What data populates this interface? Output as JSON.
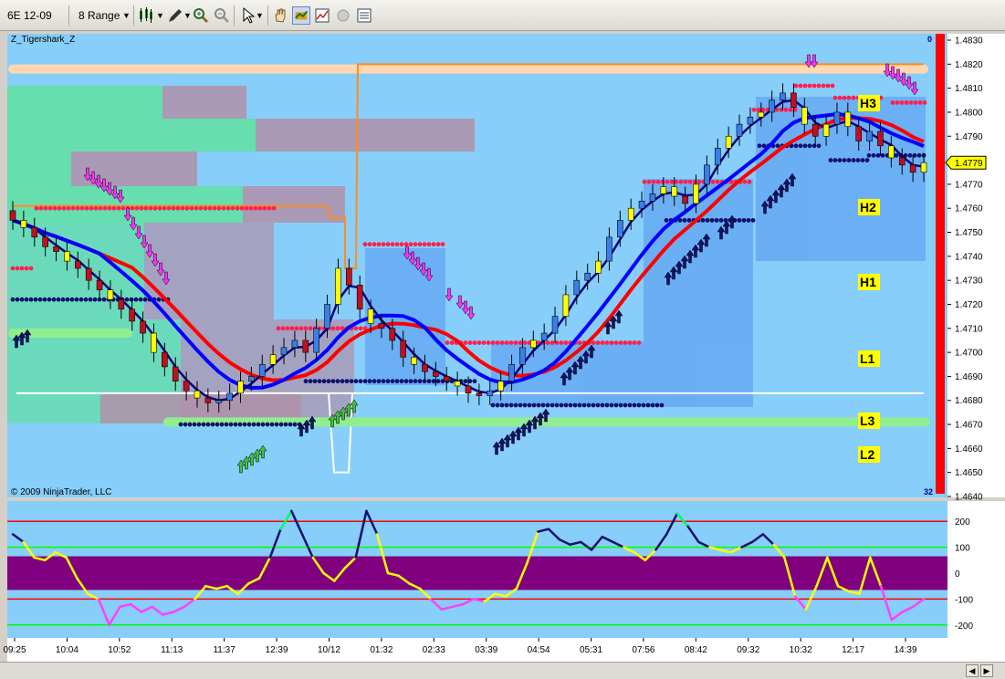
{
  "toolbar": {
    "instrument": "6E 12-09",
    "bar_type": "8 Range"
  },
  "chart_data": {
    "type": "candlestick",
    "title": "Z_Tigershark_Z",
    "copyright": "© 2009 NinjaTrader, LLC",
    "price_axis": {
      "ylim": [
        1.464,
        1.483
      ],
      "ticks": [
        "1.4830",
        "1.4820",
        "1.4810",
        "1.4800",
        "1.4790",
        "1.4780",
        "1.4770",
        "1.4760",
        "1.4750",
        "1.4740",
        "1.4730",
        "1.4720",
        "1.4710",
        "1.4700",
        "1.4690",
        "1.4680",
        "1.4670",
        "1.4660",
        "1.4650",
        "1.4640"
      ]
    },
    "last_price": "1.4779",
    "corner_top": "0",
    "corner_bottom": "32",
    "pivot_levels": [
      {
        "name": "H3",
        "price": 1.4818
      },
      {
        "name": "H2",
        "price": 1.4771
      },
      {
        "name": "H1",
        "price": 1.4741
      },
      {
        "name": "L1",
        "price": 1.471
      },
      {
        "name": "L3",
        "price": 1.4683
      },
      {
        "name": "L2",
        "price": 1.4671
      }
    ],
    "time_labels": [
      "09:25",
      "10:04",
      "10:52",
      "11:13",
      "11:37",
      "12:39",
      "10/12",
      "01:32",
      "02:33",
      "03:39",
      "04:54",
      "05:31",
      "07:56",
      "08:42",
      "09:32",
      "10:32",
      "12:17",
      "14:39"
    ],
    "close_series": [
      1.4755,
      1.4752,
      1.4748,
      1.4744,
      1.4742,
      1.4738,
      1.4735,
      1.473,
      1.4726,
      1.4722,
      1.4718,
      1.4713,
      1.4708,
      1.47,
      1.4694,
      1.4688,
      1.4684,
      1.4681,
      1.4679,
      1.468,
      1.4683,
      1.4688,
      1.469,
      1.4695,
      1.4699,
      1.4702,
      1.4705,
      1.47,
      1.471,
      1.472,
      1.4735,
      1.4728,
      1.4718,
      1.4712,
      1.471,
      1.4705,
      1.4698,
      1.4695,
      1.4692,
      1.469,
      1.4688,
      1.4686,
      1.4683,
      1.4682,
      1.4684,
      1.4688,
      1.4695,
      1.4702,
      1.4705,
      1.4708,
      1.4715,
      1.4724,
      1.473,
      1.4733,
      1.4738,
      1.4748,
      1.4755,
      1.476,
      1.4763,
      1.4766,
      1.4769,
      1.4765,
      1.4762,
      1.477,
      1.4778,
      1.4785,
      1.479,
      1.4795,
      1.4798,
      1.48,
      1.4805,
      1.4808,
      1.4802,
      1.4795,
      1.479,
      1.4795,
      1.48,
      1.4794,
      1.4788,
      1.4792,
      1.4786,
      1.4781,
      1.4778,
      1.4775,
      1.4779
    ],
    "oscillator": {
      "ylim": [
        -250,
        250
      ],
      "ticks": [
        "200",
        "100",
        "0",
        "-100",
        "-200"
      ],
      "series": [
        150,
        120,
        60,
        50,
        80,
        60,
        -20,
        -80,
        -100,
        -200,
        -130,
        -120,
        -150,
        -130,
        -160,
        -150,
        -130,
        -100,
        -50,
        -60,
        -50,
        -80,
        -40,
        -20,
        60,
        170,
        240,
        150,
        60,
        0,
        -30,
        20,
        60,
        240,
        150,
        0,
        -10,
        -40,
        -60,
        -100,
        -140,
        -130,
        -120,
        -100,
        -110,
        -80,
        -90,
        -60,
        40,
        160,
        170,
        130,
        110,
        120,
        90,
        140,
        120,
        100,
        80,
        50,
        90,
        150,
        230,
        180,
        120,
        100,
        90,
        80,
        100,
        120,
        150,
        110,
        60,
        -90,
        -140,
        -50,
        60,
        -50,
        -70,
        -80,
        60,
        -50,
        -180,
        -150,
        -130,
        -100
      ]
    },
    "colors": {
      "background": "#87cefa",
      "slow_ma": "#ff0000",
      "mid_ma": "#0000ff",
      "fast_ma": "#000080",
      "osc_band": "#800080",
      "resistance_dots": "#ff2050",
      "support_dots": "#101070"
    }
  }
}
